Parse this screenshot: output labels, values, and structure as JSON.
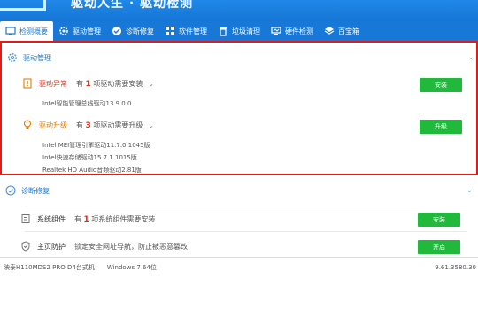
{
  "banner": {
    "title": "驱动人生 · 驱动检测"
  },
  "tabs": [
    {
      "label": "检测概要",
      "icon": "home-icon",
      "active": true
    },
    {
      "label": "驱动管理",
      "icon": "gear-icon",
      "active": false
    },
    {
      "label": "诊断修复",
      "icon": "diagnose-icon",
      "active": false
    },
    {
      "label": "软件管理",
      "icon": "software-icon",
      "active": false
    },
    {
      "label": "垃圾清理",
      "icon": "trash-icon",
      "active": false
    },
    {
      "label": "硬件检测",
      "icon": "monitor-icon",
      "active": false
    },
    {
      "label": "百宝箱",
      "icon": "toolbox-icon",
      "active": false
    }
  ],
  "driver_section": {
    "title": "驱动管理",
    "abnormal": {
      "label": "驱动异常",
      "prefix": "有",
      "count": "1",
      "suffix": "项驱动需要安装",
      "button": "安装",
      "items": [
        "Intel智能管理总线驱动13.9.0.0"
      ]
    },
    "upgrade": {
      "label": "驱动升级",
      "prefix": "有",
      "count": "3",
      "suffix": "项驱动需要升级",
      "button": "升级",
      "items": [
        "Intel MEI管理引擎驱动11.7.0.1045版",
        "Intel快速存储驱动15.7.1.1015版",
        "Realtek HD Audio音频驱动2.81版"
      ]
    }
  },
  "repair_section": {
    "title": "诊断修复",
    "components": {
      "label": "系统组件",
      "prefix": "有",
      "count": "1",
      "suffix": "项系统组件需要安装",
      "button": "安装"
    },
    "homepage": {
      "label": "主页防护",
      "text": "锁定安全网址导航，防止被恶意篡改",
      "button": "开启"
    }
  },
  "footer": {
    "machine": "映泰H110MDS2 PRO D4台式机",
    "os": "Windows 7 64位",
    "version": "9.61.3580.30"
  },
  "colors": {
    "brand_blue": "#1778d8",
    "alert_red": "#e02b16",
    "upgrade_orange": "#e57a00",
    "button_green": "#20b93b",
    "highlight_border": "#e11a1a"
  }
}
